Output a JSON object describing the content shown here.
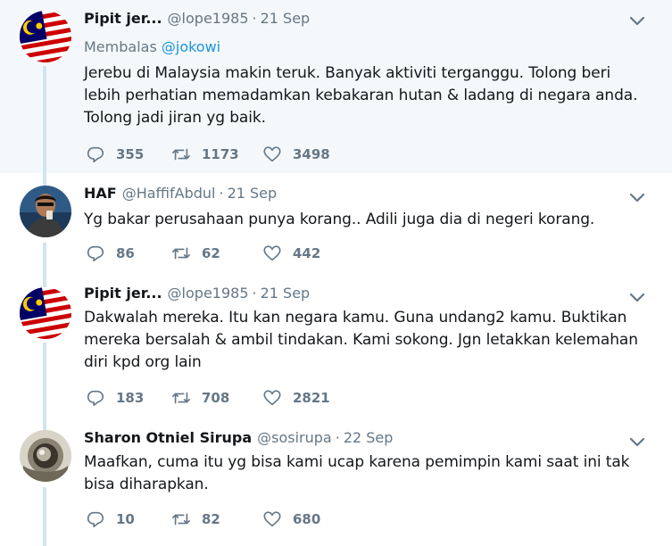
{
  "tweets": [
    {
      "name": "Pipit jer...",
      "handle": "@lope1985",
      "separator": "·",
      "date": "21 Sep",
      "reply_prefix": "Membalas",
      "reply_mention": "@jokowi",
      "text": "Jerebu di Malaysia makin teruk. Banyak aktiviti terganggu. Tolong beri lebih perhatian memadamkan kebakaran hutan & ladang di negara anda. Tolong jadi jiran yg baik.",
      "replies": "355",
      "retweets": "1173",
      "likes": "3498"
    },
    {
      "name": "HAF",
      "handle": "@HaffifAbdul",
      "separator": "·",
      "date": "21 Sep",
      "text": "Yg bakar perusahaan punya korang.. Adili juga dia di negeri korang.",
      "replies": "86",
      "retweets": "62",
      "likes": "442"
    },
    {
      "name": "Pipit jer...",
      "handle": "@lope1985",
      "separator": "·",
      "date": "21 Sep",
      "text": "Dakwalah mereka. Itu kan negara kamu. Guna undang2 kamu. Buktikan mereka bersalah & ambil tindakan. Kami sokong. Jgn letakkan kelemahan diri kpd org lain",
      "replies": "183",
      "retweets": "708",
      "likes": "2821"
    },
    {
      "name": "Sharon Otniel Sirupa",
      "handle": "@sosirupa",
      "separator": "·",
      "date": "22 Sep",
      "text": "Maafkan, cuma itu yg bisa kami ucap karena pemimpin kami saat ini tak bisa diharapkan.",
      "replies": "10",
      "retweets": "82",
      "likes": "680"
    }
  ],
  "colors": {
    "accent": "#1b95e0",
    "muted": "#657786",
    "highlight_bg": "#f5f8fa",
    "thread_line": "#cfe6f2"
  },
  "icons": {
    "reply": "reply-icon",
    "retweet": "retweet-icon",
    "like": "heart-icon",
    "more": "chevron-down-icon"
  }
}
